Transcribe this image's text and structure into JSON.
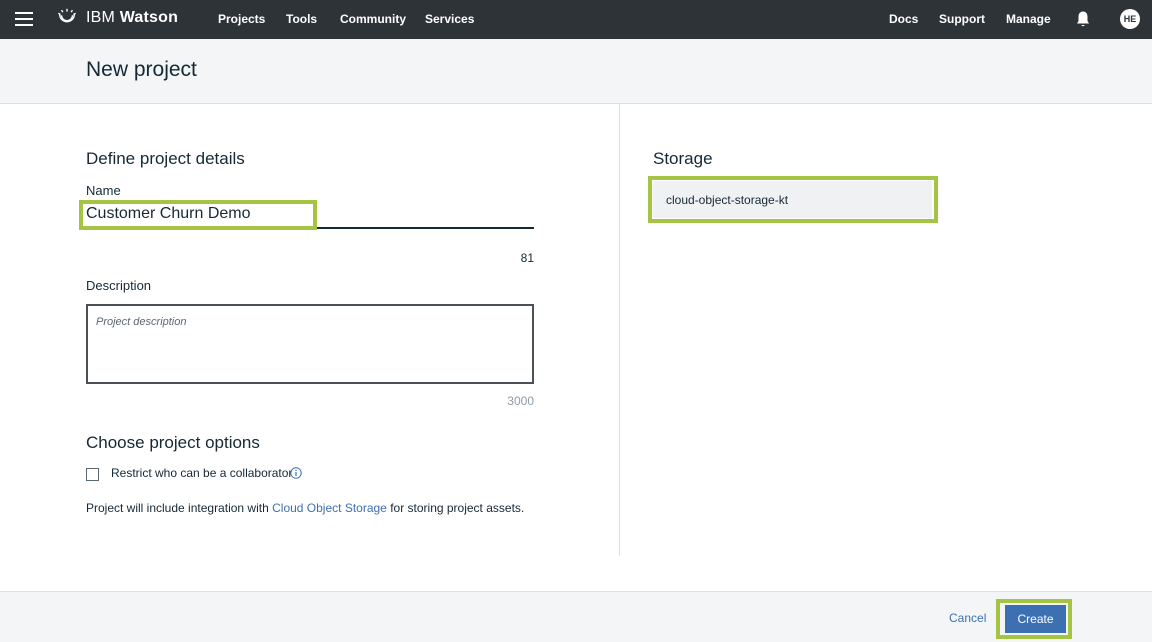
{
  "topbar": {
    "brand_prefix": "IBM",
    "brand_name": "Watson",
    "nav": [
      "Projects",
      "Tools",
      "Community",
      "Services"
    ],
    "right_links": [
      "Docs",
      "Support",
      "Manage"
    ],
    "avatar_initials": "HE"
  },
  "header": {
    "title": "New project"
  },
  "details": {
    "section_title": "Define project details",
    "name_label": "Name",
    "name_value": "Customer Churn Demo",
    "name_counter": "81",
    "description_label": "Description",
    "description_placeholder": "Project description",
    "description_counter": "3000"
  },
  "options": {
    "section_title": "Choose project options",
    "restrict_label": "Restrict who can be a collaborator",
    "restrict_checked": false,
    "integration_prefix": "Project will include integration with",
    "integration_link": "Cloud Object Storage",
    "integration_suffix": "for storing project assets."
  },
  "storage": {
    "section_title": "Storage",
    "selected": "cloud-object-storage-kt"
  },
  "footer": {
    "cancel_label": "Cancel",
    "create_label": "Create"
  },
  "colors": {
    "topbar_bg": "#2e3338",
    "accent": "#3d70b2",
    "highlight": "#a6c443"
  },
  "icons": [
    "menu-icon",
    "watson-logo-icon",
    "notification-bell-icon",
    "info-icon"
  ]
}
